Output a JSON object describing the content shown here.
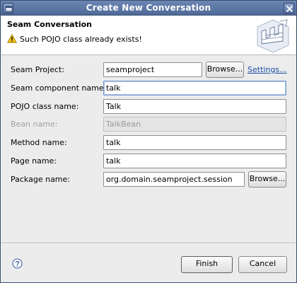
{
  "window": {
    "title": "Create New Conversation"
  },
  "banner": {
    "title": "Seam Conversation",
    "message": "Such POJO class already exists!",
    "icons": {
      "warning": "warning-icon",
      "wizard": "wizard-banner-icon"
    }
  },
  "form": {
    "seam_project": {
      "label": "Seam Project:",
      "value": "seamproject",
      "browse_label": "Browse...",
      "settings_label": "Settings..."
    },
    "component_name": {
      "label": "Seam component name:",
      "value": "talk"
    },
    "pojo_class": {
      "label": "POJO class name:",
      "value": "Talk"
    },
    "bean_name": {
      "label": "Bean name:",
      "value": "TalkBean",
      "disabled": true
    },
    "method_name": {
      "label": "Method name:",
      "value": "talk"
    },
    "page_name": {
      "label": "Page name:",
      "value": "talk"
    },
    "package_name": {
      "label": "Package name:",
      "value": "org.domain.seamproject.session",
      "browse_label": "Browse..."
    }
  },
  "footer": {
    "help_icon": "help-icon",
    "finish_label": "Finish",
    "cancel_label": "Cancel"
  },
  "colors": {
    "titlebar": "#5873a3",
    "link": "#1a4ea6",
    "dialog_bg": "#ececec"
  }
}
